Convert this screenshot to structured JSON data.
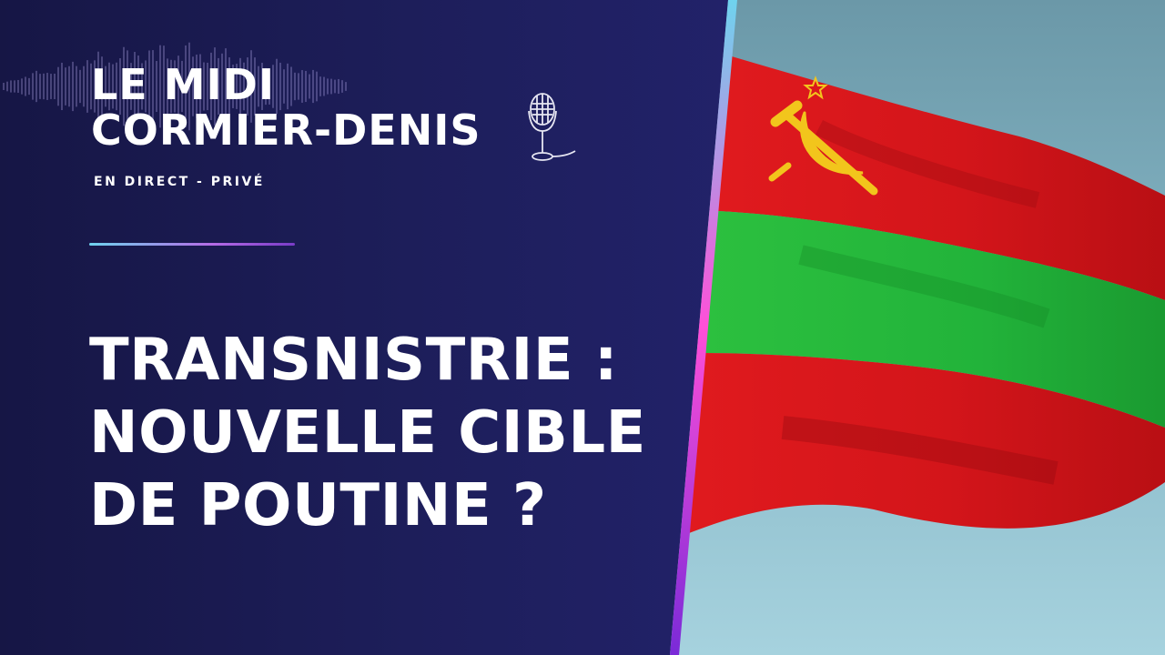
{
  "show": {
    "title_line1": "LE MIDI",
    "title_line2": "CORMIER-DENIS",
    "subtitle": "EN DIRECT - PRIVÉ"
  },
  "headline": {
    "line1": "TRANSNISTRIE :",
    "line2": "NOUVELLE CIBLE",
    "line3": "DE POUTINE ?"
  },
  "icons": {
    "microphone": "microphone-icon",
    "waveform": "audio-waveform-icon",
    "flag_emblem": "hammer-sickle-star-icon"
  },
  "colors": {
    "background": "#1c1c54",
    "text": "#ffffff",
    "flag_red": "#d8161a",
    "flag_green": "#22b33a",
    "emblem_gold": "#f2c51c",
    "sky": "#7fb4c4",
    "accent_gradient": [
      "#6fd3ee",
      "#ff4fd8",
      "#7a2ad8"
    ]
  }
}
